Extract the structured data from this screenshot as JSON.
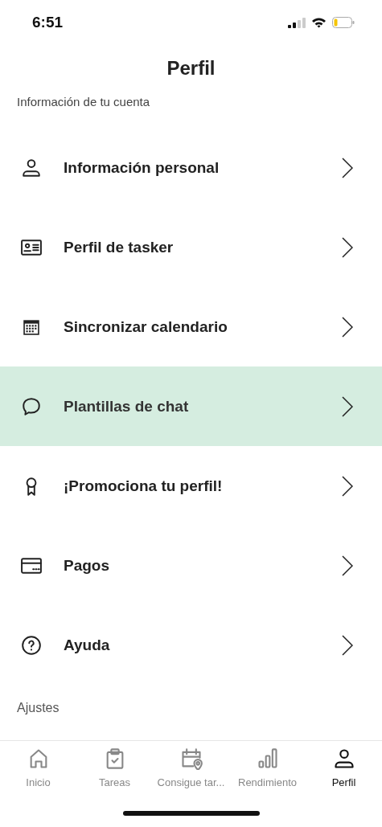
{
  "status_bar": {
    "time": "6:51"
  },
  "header": {
    "title": "Perfil"
  },
  "section_heading": "Información de tu cuenta",
  "menu_items": [
    {
      "kind": "person",
      "label": "Información personal",
      "selected": false
    },
    {
      "kind": "id-card",
      "label": "Perfil de tasker",
      "selected": false
    },
    {
      "kind": "calendar",
      "label": "Sincronizar calendario",
      "selected": false
    },
    {
      "kind": "chat",
      "label": "Plantillas de chat",
      "selected": true
    },
    {
      "kind": "ribbon",
      "label": "¡Promociona tu perfil!",
      "selected": false
    },
    {
      "kind": "card",
      "label": "Pagos",
      "selected": false
    },
    {
      "kind": "help",
      "label": "Ayuda",
      "selected": false
    }
  ],
  "settings_heading": "Ajustes",
  "tab_bar": [
    {
      "kind": "home",
      "label": "Inicio",
      "selected": false
    },
    {
      "kind": "clipboard",
      "label": "Tareas",
      "selected": false
    },
    {
      "kind": "calendar-pin",
      "label": "Consigue tar...",
      "selected": false
    },
    {
      "kind": "bars",
      "label": "Rendimiento",
      "selected": false
    },
    {
      "kind": "person",
      "label": "Perfil",
      "selected": true
    }
  ]
}
